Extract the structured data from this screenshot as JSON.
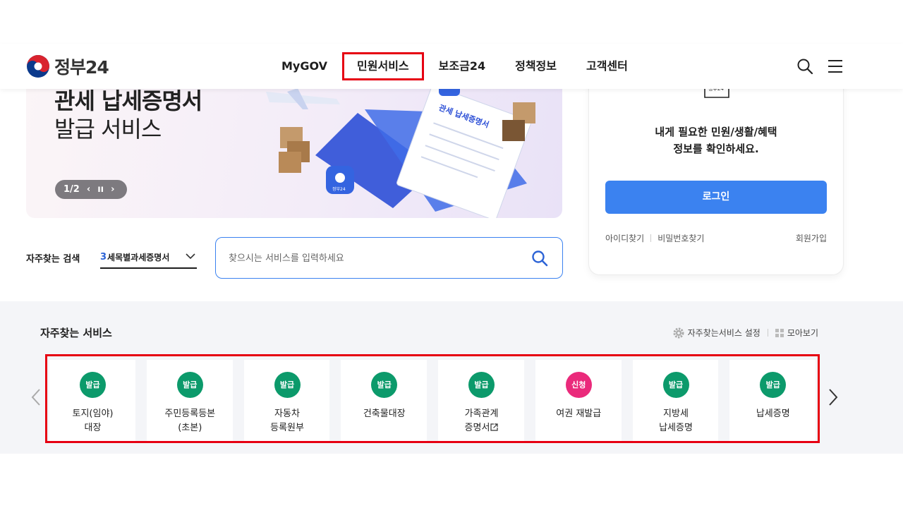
{
  "header": {
    "logo_text": "정부24",
    "nav": [
      "MyGOV",
      "민원서비스",
      "보조금24",
      "정책정보",
      "고객센터"
    ],
    "highlighted_nav": "민원서비스",
    "search_icon": "search-icon",
    "menu_icon": "hamburger-menu-icon"
  },
  "banner": {
    "title_line1": "관세 납세증명서",
    "title_line2": "발급 서비스",
    "pager": "1/2",
    "prev": "‹",
    "pause": "ıı",
    "next": "›",
    "doc_text": "관세 납세증명서",
    "logo_text": "정부24"
  },
  "login": {
    "icon_text": "정부24",
    "message_line1": "내게 필요한 민원/생활/혜택",
    "message_line2": "정보를 확인하세요.",
    "button": "로그인",
    "find_id": "아이디찾기",
    "find_pw": "비밀번호찾기",
    "join": "회원가입"
  },
  "search": {
    "label": "자주찾는 검색",
    "select_number": "3",
    "select_value": "세목별과세증명서",
    "placeholder": "찾으시는 서비스를 입력하세요"
  },
  "freq": {
    "title": "자주찾는 서비스",
    "settings": "자주찾는서비스 설정",
    "view_all": "모아보기",
    "colors": {
      "issue": "#0c9a6b",
      "apply": "#ea2a7b",
      "highlight": "#e60012"
    },
    "items": [
      {
        "badge": "발급",
        "line1": "토지(임야)",
        "line2": "대장",
        "type": "issue"
      },
      {
        "badge": "발급",
        "line1": "주민등록등본",
        "line2": "(초본)",
        "type": "issue"
      },
      {
        "badge": "발급",
        "line1": "자동차",
        "line2": "등록원부",
        "type": "issue"
      },
      {
        "badge": "발급",
        "line1": "건축물대장",
        "line2": "",
        "type": "issue"
      },
      {
        "badge": "발급",
        "line1": "가족관계",
        "line2": "증명서",
        "type": "issue",
        "external": true
      },
      {
        "badge": "신청",
        "line1": "여권 재발급",
        "line2": "",
        "type": "apply"
      },
      {
        "badge": "발급",
        "line1": "지방세",
        "line2": "납세증명",
        "type": "issue"
      },
      {
        "badge": "발급",
        "line1": "납세증명",
        "line2": "",
        "type": "issue"
      }
    ]
  }
}
